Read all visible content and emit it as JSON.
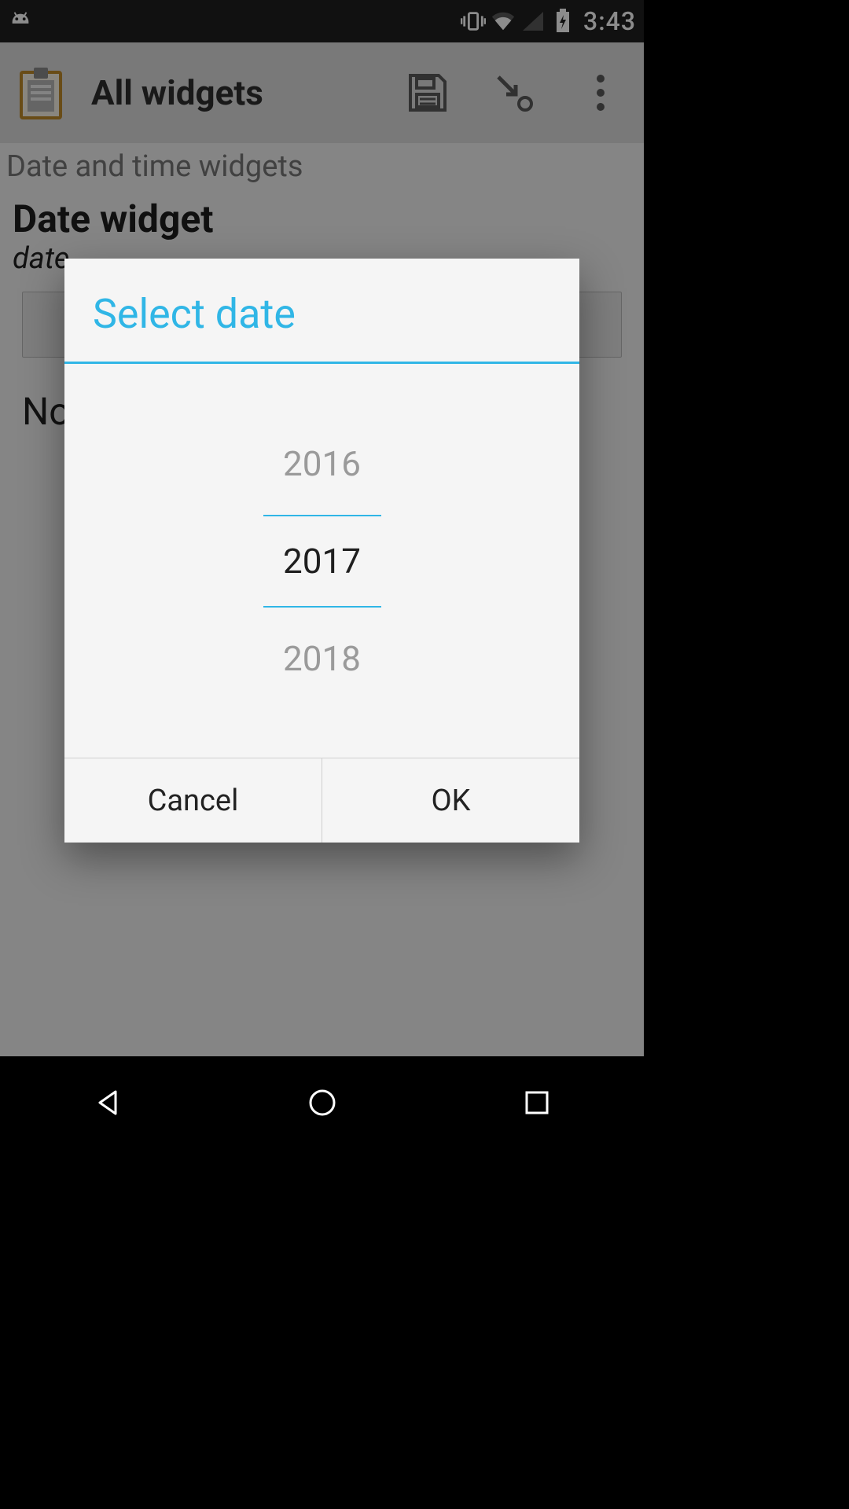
{
  "statusbar": {
    "time": "3:43"
  },
  "toolbar": {
    "title": "All widgets"
  },
  "content": {
    "section_label": "Date and time widgets",
    "item_title": "Date widget",
    "item_sub_prefix": "date",
    "no_text_prefix": "No"
  },
  "dialog": {
    "title": "Select date",
    "prev_year": "2016",
    "selected_year": "2017",
    "next_year": "2018",
    "cancel_label": "Cancel",
    "ok_label": "OK"
  }
}
